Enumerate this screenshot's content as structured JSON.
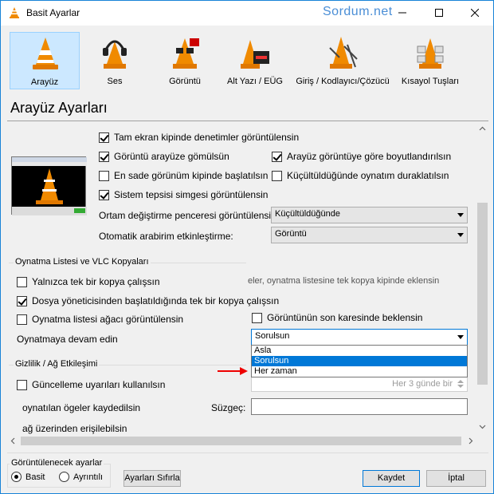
{
  "window": {
    "title": "Basit Ayarlar",
    "watermark": "Sordum.net",
    "accent": "#1883d7"
  },
  "categories": [
    {
      "label": "Arayüz",
      "icon": "vlc-cone-icon",
      "active": true
    },
    {
      "label": "Ses",
      "icon": "headphones-cone-icon"
    },
    {
      "label": "Görüntü",
      "icon": "glasses-cone-icon"
    },
    {
      "label": "Alt Yazı / EÜG",
      "icon": "subtitle-cone-icon"
    },
    {
      "label": "Giriş / Kodlayıcı/Çözücü",
      "icon": "cable-cone-icon"
    },
    {
      "label": "Kısayol Tuşları",
      "icon": "hotkey-cone-icon"
    }
  ],
  "section_title": "Arayüz Ayarları",
  "interface": {
    "fullscreen_controls": "Tam ekran kipinde denetimler görüntülensin",
    "embed_video": "Görüntü arayüze gömülsün",
    "resize_to_video": "Arayüz görüntüye göre boyutlandırılsın",
    "minimal_start": "En sade görünüm kipinde başlatılsın",
    "pause_minimized": "Küçültüldüğünde oynatım duraklatılsın",
    "systray": "Sistem tepsisi simgesi görüntülensin",
    "media_change_label": "Ortam değiştirme penceresi görüntülensin:",
    "media_change_value": "Küçültüldüğünde",
    "auto_raise_label": "Otomatik arabirim etkinleştirme:",
    "auto_raise_value": "Görüntü"
  },
  "playlist": {
    "group_title": "Oynatma Listesi ve VLC Kopyaları",
    "single_instance": "Yalnızca tek bir kopya çalışsın",
    "single_instance_note": "eler, oynatma listesine tek kopya kipinde eklensin",
    "one_instance_file": "Dosya yöneticisinden başlatıldığında tek bir kopya çalışsın",
    "tree_view": "Oynatma listesi ağacı görüntülensin",
    "pause_last_frame": "Görüntünün son karesinde beklensin",
    "continue_label": "Oynatmaya devam edin",
    "continue_value": "Sorulsun",
    "continue_options": [
      "Asla",
      "Sorulsun",
      "Her zaman"
    ],
    "continue_selected_index": 1
  },
  "privacy": {
    "group_title": "Gizlilik / Ağ Etkileşimi",
    "updates": "Güncelleme uyarıları kullanılsın",
    "update_interval": "Her 3 günde bir",
    "recent_items": "oynatılan ögeler kaydedilsin",
    "filter_label": "Süzgeç:",
    "filter_value": "",
    "network": "ağ üzerinden erişilebilsin"
  },
  "footer": {
    "show_settings_label": "Görüntülenecek ayarlar",
    "simple": "Basit",
    "detailed": "Ayrıntılı",
    "reset": "Ayarları Sıfırla",
    "save": "Kaydet",
    "cancel": "İptal"
  }
}
